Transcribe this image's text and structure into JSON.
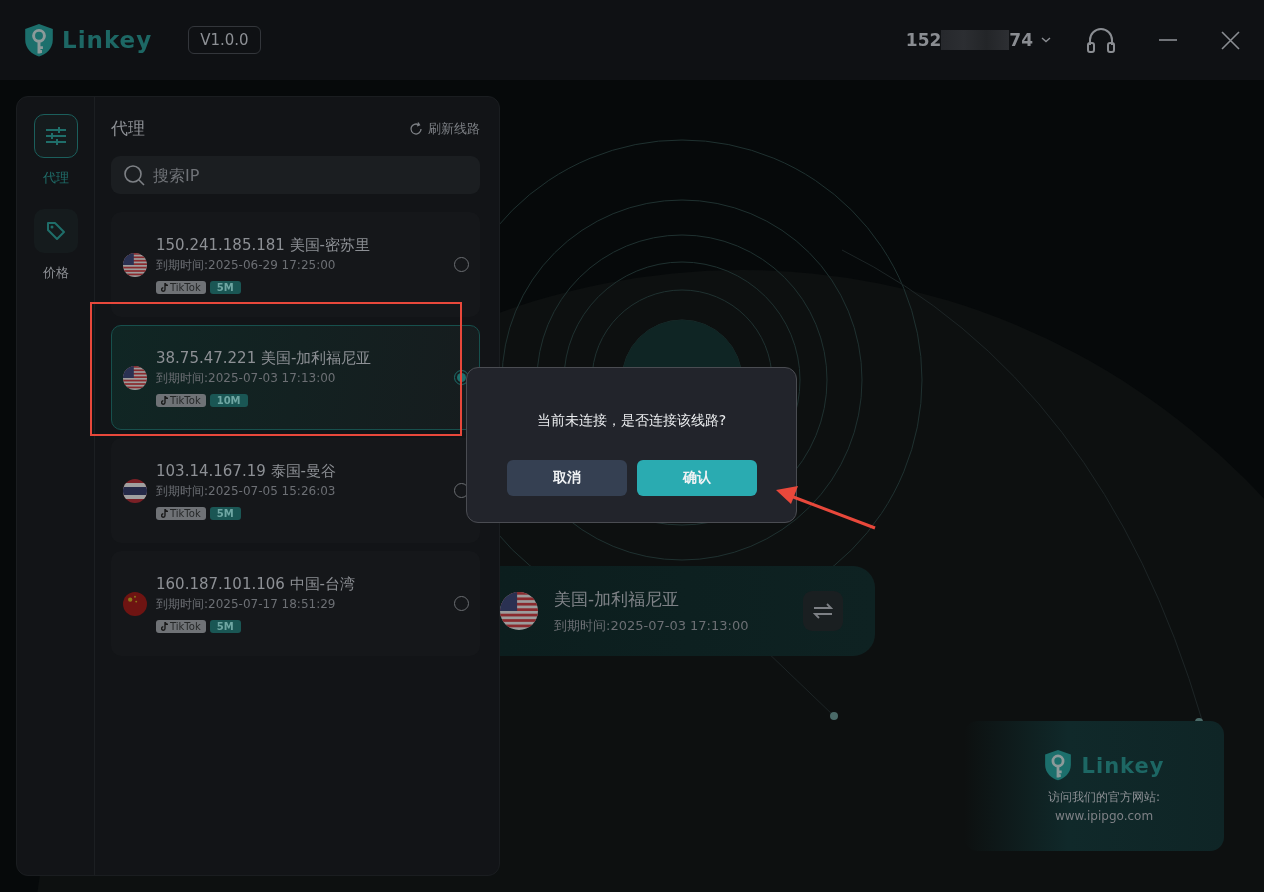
{
  "header": {
    "logo_text": "Linkey",
    "version": "V1.0.0",
    "account_prefix": "152",
    "account_suffix": "74"
  },
  "nav": [
    {
      "label": "代理",
      "kind": "proxy",
      "selected": true
    },
    {
      "label": "价格",
      "kind": "price",
      "selected": false
    }
  ],
  "proxy_panel": {
    "title": "代理",
    "refresh": "刷新线路",
    "search_placeholder": "搜索IP",
    "items": [
      {
        "title": "150.241.185.181 美国-密苏里",
        "kind": "us",
        "expiry": "到期时间:2025-06-29 17:25:00",
        "app": "TikTok",
        "bandwidth": "5M",
        "selected": false
      },
      {
        "title": "38.75.47.221 美国-加利福尼亚",
        "kind": "us",
        "expiry": "到期时间:2025-07-03 17:13:00",
        "app": "TikTok",
        "bandwidth": "10M",
        "selected": true
      },
      {
        "title": "103.14.167.19 泰国-曼谷",
        "kind": "th",
        "expiry": "到期时间:2025-07-05 15:26:03",
        "app": "TikTok",
        "bandwidth": "5M",
        "selected": false
      },
      {
        "title": "160.187.101.106 中国-台湾",
        "kind": "cn",
        "expiry": "到期时间:2025-07-17 18:51:29",
        "app": "TikTok",
        "bandwidth": "5M",
        "selected": false
      }
    ]
  },
  "current": {
    "kind": "us",
    "location": "美国-加利福尼亚",
    "expiry": "到期时间:2025-07-03 17:13:00"
  },
  "promo": {
    "logo_text": "Linkey",
    "caption": "访问我们的官方网站:",
    "url": "www.ipipgo.com"
  },
  "dialog": {
    "message": "当前未连接，是否连接该线路?",
    "buttons": [
      {
        "label": "取消",
        "kind": "cancel"
      },
      {
        "label": "确认",
        "kind": "confirm"
      }
    ]
  }
}
